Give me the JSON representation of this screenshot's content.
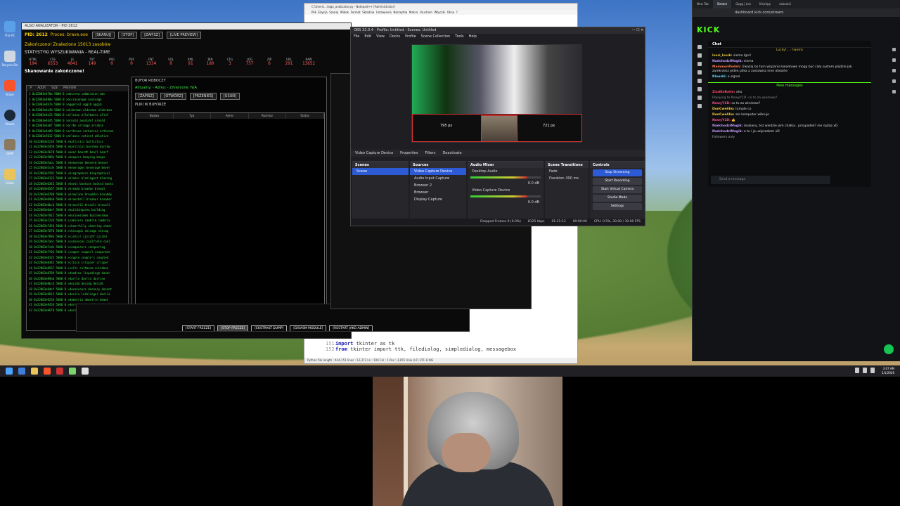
{
  "desktop": {
    "icons": [
      "This PC",
      "Recycle Bin",
      "Brave",
      "Steam",
      "GIMP",
      "Folder"
    ]
  },
  "monitor": {
    "title": "ALGO ANALIZATOR - PID 2612",
    "pid_line": "PID: 2612",
    "proc_line": "Proces: brave.exe",
    "found_line": "Zakończono! Znaleziono 15013 zasobów",
    "stats_title": "STATYSTYKI WYSZUKIWANIA - REAL-TIME",
    "buttons": [
      "[SKANUJ]",
      "[STOP]",
      "[ZAPISZ]",
      "[LIVE PREVIEW]"
    ],
    "stats": [
      {
        "label": "HTML",
        "value": "194"
      },
      {
        "label": "CSS",
        "value": "6553"
      },
      {
        "label": "JS",
        "value": "4041"
      },
      {
        "label": "TXT",
        "value": "149"
      },
      {
        "label": "IMG",
        "value": "0"
      },
      {
        "label": "PDF",
        "value": "0"
      },
      {
        "label": "FNT",
        "value": "1334"
      },
      {
        "label": "SQL",
        "value": "0"
      },
      {
        "label": "XML",
        "value": "91"
      },
      {
        "label": "BIN",
        "value": "180"
      },
      {
        "label": "CFG",
        "value": "3"
      },
      {
        "label": "LOG",
        "value": "757"
      },
      {
        "label": "ZIP",
        "value": "6"
      },
      {
        "label": "URL",
        "value": "291"
      },
      {
        "label": "RAW",
        "value": "13652"
      }
    ],
    "scan_done": "Skanowanie zakończone!",
    "list_cols": [
      "#",
      "ADDR",
      "SIZE",
      "PREVIEW"
    ],
    "rows": [
      "1  0x22003e470a 5000 0  >abc>>ea submission abc",
      "2  0x22003e480e 5000 0  >accrasonage acessage",
      "3  0x22003e4b7a 5000 0  >aggerval aggib aggib",
      "4  0x22003e4a38 5000 0  >alderman aldermen alderman",
      "5  0x22003e4e23 5000 0  >allnine allofmatic allof",
      "6  0x22003e4d45 5000 0  >arnold annaldof arnold",
      "7  0x22003e4a67 5000 0  >arrbn arrange arrable",
      "8  0x22003e4e89 5000 0  >arthrone carbonrec arthrone",
      "9  0x22003e5012 5000 0  >atlases catiest ablative",
      "10 0x22003e5234 5000 0  >ballistic ballistics",
      "11 0x22003e5456 5000 0  >barsticul barshow barshw",
      "12 0x22003e5678 5000 0  >bear boardt bearl bearf",
      "13 0x22003e589a 5000 0  >beepers beeping beeps",
      "14 0x22003e5abc 5000 0  >beeverme beeverm beever",
      "15 0x22003e5cde 5000 0  >beverages beverage bever",
      "16 0x22003e5f01 5000 0  >biographers biographical",
      "17 0x22003e6123 5000 0  >blazer blazingest blazing",
      "18 0x22003e6345 5000 0  >boots bootson bootsd boots",
      "19 0x22003e6567 5000 0  >breadd breadan breadi",
      "20 0x22003e6789 5000 0  >brouline brouddin brouddy",
      "21 0x22003e69ab 5000 0  >brunchell breaker breaker",
      "22 0x22003e6bcd 5000 0  >brocoli1 brocoli brocoli",
      "23 0x22003e6def 5000 0  >buildingarea building",
      "24 0x22003e7012 5000 0  >businessmen businessman",
      "25 0x22003e7234 5000 0  >camicero cambrim cambrix",
      "26 0x22003e7456 5000 0  >cheerfully cheering cheer",
      "27 0x22003e7678 5000 0  >chicago1 chicago chicag",
      "28 0x22003e789a 5000 0  >cjchsir cjsichf cjichd",
      "29 0x22003e7abc 5000 0  >coalesces coalfield coal",
      "30 0x22003e7cde 5000 0  >conquerors conquering",
      "31 0x22003e7f01 5000 0  >cooper cooperl cooperate",
      "32 0x22003e8123 5000 0  >couple couple's coupled",
      "33 0x22003e8345 5000 0  >crisco crispier crisper",
      "34 0x22003e8567 5000 0  >culti cultbecm culteben",
      "35 0x22003e8789 5000 0  >dandrea lispedinge dandr",
      "36 0x22003e89ab 5000 0  >darrin darrin darrine",
      "37 0x22003e8bcd 5000 0  >decidd decidg decidh",
      "38 0x22003e8def 5000 0  >decensoure decency decent",
      "39 0x22003e9012 5000 0  >decile leiblinger decile",
      "40 0x22003e9234 5000 0  >demetria demetrin demet",
      "41 0x22003e9456 5000 0  >derridge derridger derri",
      "42 0x22003e9678 5000 0  >dersuanese dersuaneal"
    ],
    "workbuf_title": "BUFOR ROBOCZY",
    "workbuf_fields": "Aktualny:  -  Adres:  -  Zmienione:  N/A",
    "workbuf_buttons": [
      "[ZAPISZ]",
      "[OTWÓRZ]",
      "[PRZENIEŚ]",
      "[USUŃ]"
    ],
    "files_title": "PLIKI W BUFORZE",
    "file_cols": [
      "Nazwa",
      "Typ",
      "Adres",
      "Rozmiar",
      "Status"
    ],
    "bottom_buttons": [
      "[START FREEZE]",
      "[STOP FREEZE]",
      "[EKSTRAKT DUMP]",
      "[DISASM MODULE]",
      "[RESTART JAKO ADMIN]"
    ]
  },
  "editor": {
    "title": "C:\\Users\\...\\algo_analizator.py - Notepad++ [Administrator]",
    "menu": [
      "Plik",
      "Edycja",
      "Szukaj",
      "Widok",
      "Format",
      "Składnia",
      "Ustawienia",
      "Narzędzia",
      "Makra",
      "Uruchom",
      "Wtyczki",
      "Okna",
      "?"
    ],
    "lines": [
      {
        "num": "151",
        "kw": "import",
        "rest": " tkinter as tk"
      },
      {
        "num": "152",
        "kw": "from",
        "rest": " tkinter import ttk, filedialog, simpledialog, messagebox"
      }
    ],
    "status": "Python file        length : 444,151   lines : 12,372       Ln : 100   Col : 1   Pos : 3,855       Unix (LF)        UTF-8        INS"
  },
  "obs": {
    "title": "OBS 32.0.4 - Profile: Untitled - Scenes: Untitled",
    "menu": [
      "File",
      "Edit",
      "View",
      "Docks",
      "Profile",
      "Scene Collection",
      "Tools",
      "Help"
    ],
    "dim_left": "795 px",
    "dim_right": "721 px",
    "src_toolbar": [
      "Video Capture Device",
      "Properties",
      "Filters",
      "Deactivate"
    ],
    "scenes_title": "Scenes",
    "scenes": [
      "Scene"
    ],
    "sources_title": "Sources",
    "sources": [
      "Video Capture Device",
      "Audio Input Capture",
      "Browser 2",
      "Browser",
      "Display Capture"
    ],
    "mixer_title": "Audio Mixer",
    "mixer": [
      {
        "name": "Desktop Audio",
        "db": "0.0 dB"
      },
      {
        "name": "Video Capture Device",
        "db": "0.0 dB"
      }
    ],
    "transitions_title": "Scene Transitions",
    "transition": "Fade",
    "duration_label": "Duration",
    "duration": "300 ms",
    "controls_title": "Controls",
    "controls": [
      "Stop Streaming",
      "Start Recording",
      "Start Virtual Camera",
      "Studio Mode",
      "Settings"
    ],
    "status": [
      "Dropped Frames 0 (0.0%)",
      "8125 kbps",
      "01:21:13",
      "00:00:00",
      "CPU: 0.5%, 30.00 / 30.00 FPS"
    ]
  },
  "browser": {
    "tabs": [
      "New Tab",
      "Stream",
      "Opgg | Leo",
      "KickApp",
      "sabaduli"
    ],
    "url": "dashboard.kick.com/stream",
    "logo": "KICK",
    "chat_title": "Chat",
    "pinned": "Lucky!...",
    "pinned_count": "twoms",
    "messages": [
      {
        "user": "lossi_lossk:",
        "color": "#e0c040",
        "text": "siema Igor!"
      },
      {
        "user": "NadchodziMagik:",
        "color": "#c99bff",
        "text": "siema"
      },
      {
        "user": "MammonPodah:",
        "color": "#ff7a50",
        "text": "Uważaj bo tam wiązania kwantowe mogą być cały system pójdzie jak zamkniesz jeden plika a zostawisz inne otwarte"
      },
      {
        "user": "Klouski:",
        "color": "#6fd6ff",
        "text": "o signal"
      }
    ],
    "new_messages": "New messages",
    "messages2": [
      {
        "user": "ZiadKeBatie:",
        "color": "#ff4466",
        "text": "oho"
      },
      {
        "user": "NowyY1D:",
        "color": "#ff4f8b",
        "text": "co to za windows?"
      },
      {
        "user": "DonCwelilio:",
        "color": "#ffcc33",
        "text": "tample co"
      },
      {
        "user": "DonCwelilio:",
        "color": "#ffcc33",
        "text": "ale komputer wibruje"
      },
      {
        "user": "NowyY1D:",
        "color": "#ff4f8b",
        "text": "👍"
      },
      {
        "user": "NadchodziMagik:",
        "color": "#c99bff",
        "text": "skubany, też wiedzie jem chałka.. przypadek? nie sądzę xD"
      },
      {
        "user": "NadchodziMagik:",
        "color": "#c99bff",
        "text": "a to i ja usłyszałem xD"
      }
    ],
    "reply_note": "Replying to NowyY1D: co to za windows?",
    "followers_only": "Followers only",
    "input_placeholder": "Send a message"
  },
  "taskbar": {
    "time": "3:07 AM",
    "date": "2/1/2026"
  }
}
